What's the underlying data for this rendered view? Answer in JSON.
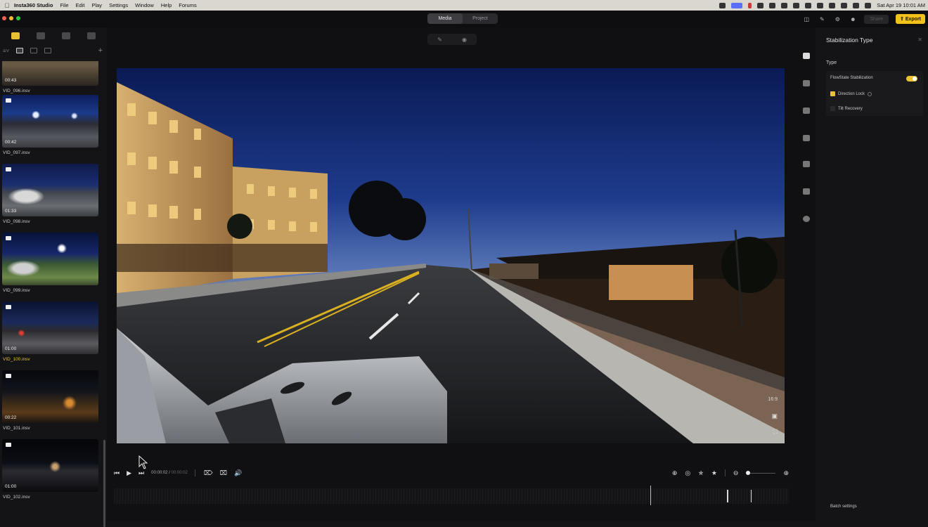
{
  "menubar": {
    "app_name": "Insta360 Studio",
    "items": [
      "File",
      "Edit",
      "Play",
      "Settings",
      "Window",
      "Help",
      "Forums"
    ],
    "clock": "Sat Apr 19  10:01 AM"
  },
  "titlebar": {
    "tabs": [
      {
        "label": "Media",
        "active": true
      },
      {
        "label": "Project",
        "active": false
      }
    ],
    "share_label": "Share",
    "export_label": "Export",
    "export_color": "#f2c21b"
  },
  "library": {
    "clips": [
      {
        "name": "VID_096.insv",
        "duration": "00:43",
        "selected": false
      },
      {
        "name": "VID_097.insv",
        "duration": "00:42",
        "selected": false
      },
      {
        "name": "VID_098.insv",
        "duration": "01:33",
        "selected": false
      },
      {
        "name": "VID_099.insv",
        "duration": "",
        "selected": false
      },
      {
        "name": "VID_100.insv",
        "duration": "01:00",
        "selected": true
      },
      {
        "name": "VID_101.insv",
        "duration": "00:22",
        "selected": false
      },
      {
        "name": "VID_102.insv",
        "duration": "01:00",
        "selected": false
      }
    ]
  },
  "viewer": {
    "aspect_ratio": "16:9"
  },
  "playback": {
    "current_time": "00:00:02",
    "total_time": "00:00:02"
  },
  "stabilization": {
    "title": "Stabilization Type",
    "section": "Type",
    "flowstate_label": "FlowState Stabilization",
    "flowstate_on": true,
    "direction_lock_label": "Direction Lock",
    "direction_lock_checked": true,
    "tilt_recovery_label": "Tilt Recovery",
    "tilt_recovery_checked": false,
    "batch_label": "Batch settings"
  },
  "accent": "#e8c230"
}
